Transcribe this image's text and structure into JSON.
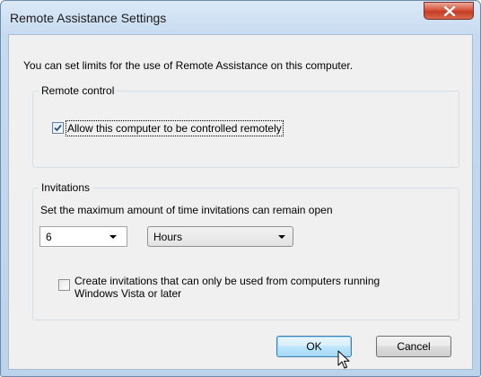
{
  "window": {
    "title": "Remote Assistance Settings"
  },
  "intro_text": "You can set limits for the use of Remote Assistance on this computer.",
  "remote_control": {
    "legend": "Remote control",
    "allow_label": "Allow this computer to be controlled remotely",
    "allow_checked": true
  },
  "invitations": {
    "legend": "Invitations",
    "duration_label": "Set the maximum amount of time invitations can remain open",
    "amount_value": "6",
    "unit_value": "Hours",
    "vista_label_line1": "Create invitations that can only be used from computers running",
    "vista_label_line2": "Windows Vista or later",
    "vista_checked": false
  },
  "buttons": {
    "ok": "OK",
    "cancel": "Cancel"
  },
  "icons": {
    "close": "close-icon",
    "check": "checkmark-icon",
    "dropdown": "chevron-down-icon",
    "cursor": "mouse-pointer-icon"
  }
}
